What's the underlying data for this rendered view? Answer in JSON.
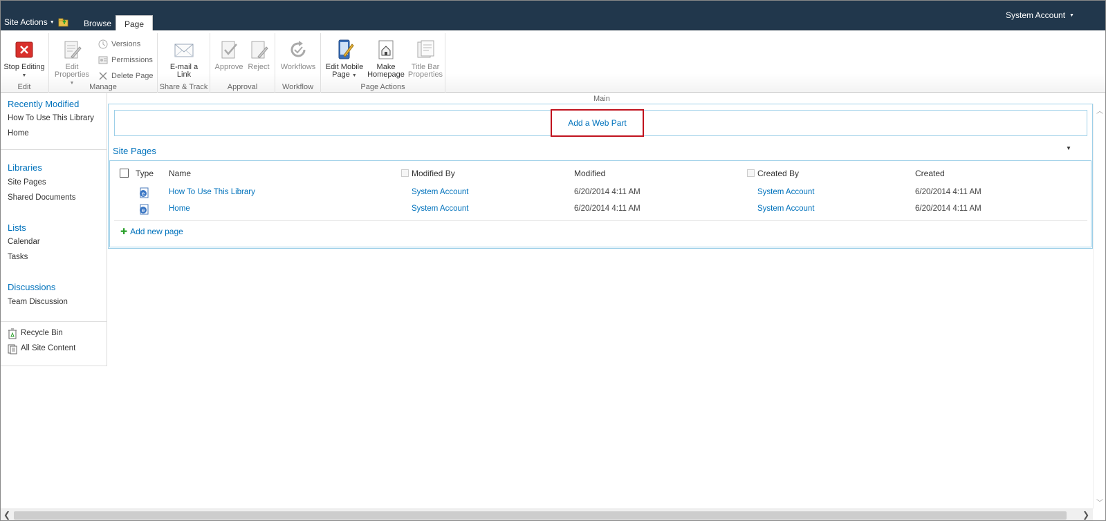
{
  "topbar": {
    "site_actions": "Site Actions",
    "tabs": [
      {
        "label": "Browse"
      },
      {
        "label": "Page"
      }
    ],
    "user": "System Account"
  },
  "ribbon": {
    "groups": {
      "edit": "Edit",
      "manage": "Manage",
      "share": "Share & Track",
      "approval": "Approval",
      "workflow": "Workflow",
      "page_actions": "Page Actions"
    },
    "buttons": {
      "stop_editing": "Stop Editing",
      "edit_properties_1": "Edit",
      "edit_properties_2": "Properties",
      "versions": "Versions",
      "permissions": "Permissions",
      "delete_page": "Delete Page",
      "email_link_1": "E-mail a",
      "email_link_2": "Link",
      "approve": "Approve",
      "reject": "Reject",
      "workflows": "Workflows",
      "edit_mobile_1": "Edit Mobile",
      "edit_mobile_2": "Page",
      "make_homepage_1": "Make",
      "make_homepage_2": "Homepage",
      "title_bar_1": "Title Bar",
      "title_bar_2": "Properties"
    },
    "colors": {
      "stop_editing": "#d9302c",
      "accent": "#0072bc"
    }
  },
  "leftnav": {
    "recently_modified": {
      "heading": "Recently Modified",
      "items": [
        "How To Use This Library",
        "Home"
      ]
    },
    "libraries": {
      "heading": "Libraries",
      "items": [
        "Site Pages",
        "Shared Documents"
      ]
    },
    "lists": {
      "heading": "Lists",
      "items": [
        "Calendar",
        "Tasks"
      ]
    },
    "discussions": {
      "heading": "Discussions",
      "items": [
        "Team Discussion"
      ]
    },
    "footer": [
      "Recycle Bin",
      "All Site Content"
    ]
  },
  "main": {
    "zone_label": "Main",
    "add_web_part": "Add a Web Part",
    "webpart_title": "Site Pages",
    "columns": [
      "Type",
      "Name",
      "Modified By",
      "Modified",
      "Created By",
      "Created"
    ],
    "rows": [
      {
        "name": "How To Use This Library",
        "modified_by": "System Account",
        "modified": "6/20/2014 4:11 AM",
        "created_by": "System Account",
        "created": "6/20/2014 4:11 AM"
      },
      {
        "name": "Home",
        "modified_by": "System Account",
        "modified": "6/20/2014 4:11 AM",
        "created_by": "System Account",
        "created": "6/20/2014 4:11 AM"
      }
    ],
    "add_new_page": "Add new page"
  }
}
